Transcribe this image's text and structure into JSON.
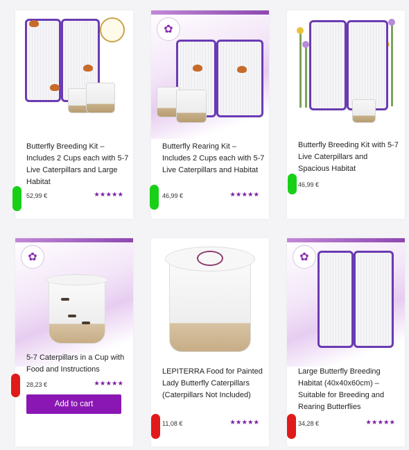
{
  "products": [
    {
      "title": "Butterfly Breeding Kit – Includes 2 Cups each with 5-7 Live Caterpillars and Large Habitat",
      "price": "52,99 €",
      "rating": "★★★★★"
    },
    {
      "title": "Butterfly Rearing Kit – Includes 2 Cups each with 5-7 Live Caterpillars and Habitat",
      "price": "46,99 €",
      "rating": "★★★★★"
    },
    {
      "title": "Butterfly Breeding Kit with 5-7 Live Caterpillars and Spacious Habitat",
      "price": "46,99 €",
      "rating": ""
    },
    {
      "title": "5-7 Caterpillars in a Cup with Food and Instructions",
      "price": "28,23 €",
      "rating": "★★★★★",
      "button": "Add to cart"
    },
    {
      "title": "LEPITERRA Food for Painted Lady Butterfly Caterpillars (Caterpillars Not Included)",
      "price": "11,08 €",
      "rating": "★★★★★"
    },
    {
      "title": "Large Butterfly Breeding Habitat (40x40x60cm) – Suitable for Breeding and Rearing Butterflies",
      "price": "34,28 €",
      "rating": "★★★★★"
    }
  ],
  "colors": {
    "accent": "#8a17b4",
    "star": "#7a1fa2",
    "marker_green": "#18d018",
    "marker_red": "#e01a1a"
  }
}
